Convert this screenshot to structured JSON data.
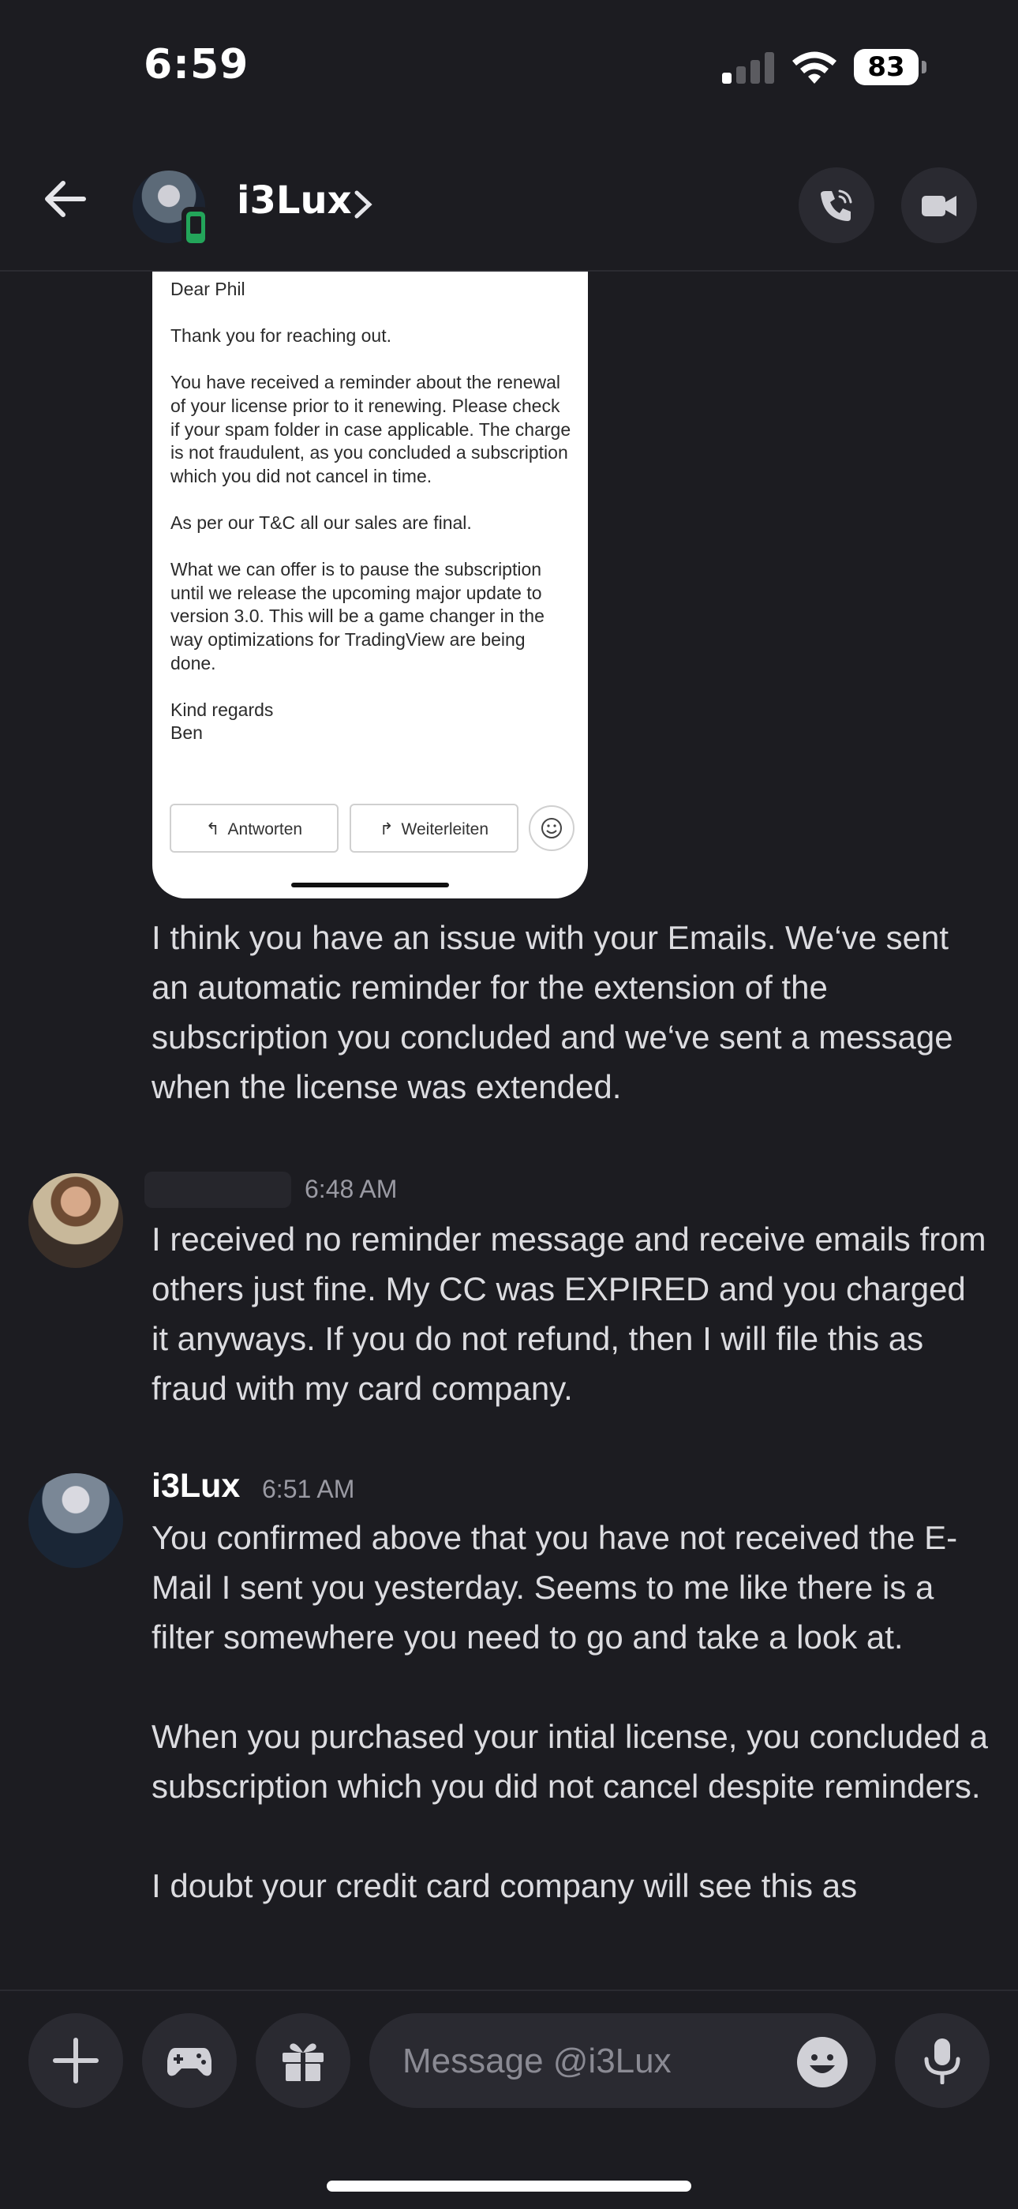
{
  "status_bar": {
    "time": "6:59",
    "battery": "83"
  },
  "header": {
    "name": "i3Lux"
  },
  "email": {
    "greeting": "Dear Phil",
    "paragraphs": [
      "Thank you for reaching out.",
      "You have received a reminder about the renewal of your license prior to it renewing. Please check if your spam folder in case applicable. The charge is not fraudulent, as you concluded a subscription which you did not cancel in time.",
      "As per our T&C all our sales are final.",
      "What we can offer is to pause the subscription until we release the upcoming major update to version 3.0. This will be a game changer in the way optimizations for TradingView are being done."
    ],
    "closing": "Kind regards",
    "signature": "Ben",
    "reply_label": "Antworten",
    "forward_label": "Weiterleiten"
  },
  "messages": [
    {
      "author": "i3Lux",
      "paragraphs": [
        "I think you have an issue with your Emails. We‘ve sent an automatic reminder for the extension of the subscription you concluded and we‘ve sent a message when the license was extended."
      ]
    },
    {
      "author": "",
      "time": "6:48 AM",
      "paragraphs": [
        "I received no reminder message and receive emails from others just fine. My CC was EXPIRED and you charged it anyways. If you do not refund, then I will file this as fraud with my card company."
      ]
    },
    {
      "author": "i3Lux",
      "time": "6:51 AM",
      "paragraphs": [
        "You confirmed above that you have not received the E-Mail I sent you yesterday. Seems to me like there is a filter somewhere you need to go and take a look at.",
        "When you purchased your intial license, you concluded a subscription which you did not cancel despite reminders.",
        "I doubt your credit card company will see this as"
      ]
    }
  ],
  "composer": {
    "placeholder": "Message @i3Lux"
  },
  "colors": {
    "background": "#1c1c21",
    "online": "#23a55a",
    "button": "#2a2a31"
  }
}
